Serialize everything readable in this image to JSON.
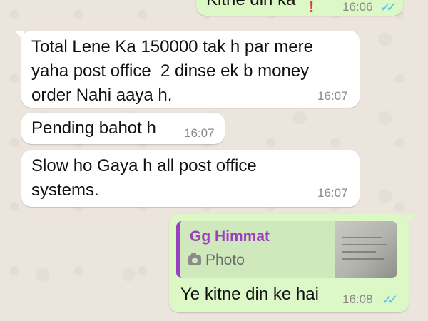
{
  "messages": [
    {
      "direction": "out",
      "text": "Kitne din ka",
      "time": "16:06",
      "status": "read"
    },
    {
      "direction": "in",
      "text": "Total Lene Ka 150000 tak h par mere\nyaha post office  2 dinse ek b money\norder Nahi aaya h.",
      "time": "16:07"
    },
    {
      "direction": "in",
      "text": "Pending bahot h",
      "time": "16:07"
    },
    {
      "direction": "in",
      "text": "Slow ho Gaya h all post office\nsystems.",
      "time": "16:07"
    },
    {
      "direction": "out",
      "quote": {
        "author": "Gg Himmat",
        "type": "Photo"
      },
      "text": "Ye kitne din ke hai",
      "time": "16:08",
      "status": "read"
    }
  ],
  "colors": {
    "background": "#ece5dd",
    "incoming_bubble": "#ffffff",
    "outgoing_bubble": "#dcf8c6",
    "read_ticks": "#4fc3f7",
    "quote_author": "#9c3fc2"
  },
  "icons": {
    "read_receipt": "double-check-icon",
    "quote_media": "camera-icon",
    "error": "exclamation-icon"
  }
}
